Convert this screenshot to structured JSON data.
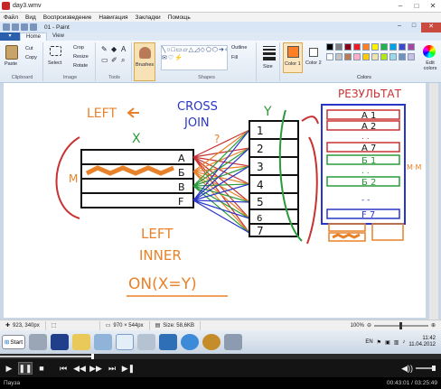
{
  "player": {
    "title": "day3.wmv",
    "menu": [
      "Файл",
      "Вид",
      "Воспроизведение",
      "Навигация",
      "Закладки",
      "Помощь"
    ],
    "status": "Пауза",
    "time": "00:43:01 / 03:25:49",
    "progress": 0.21
  },
  "paint": {
    "title": "01 - Paint",
    "tabs": [
      "Home",
      "View"
    ],
    "ribbon": {
      "clipboard": {
        "paste": "Paste",
        "cut": "Cut",
        "copy": "Copy",
        "label": "Clipboard"
      },
      "image": {
        "select": "Select",
        "crop": "Crop",
        "resize": "Resize",
        "rotate": "Rotate",
        "label": "Image"
      },
      "tools": {
        "label": "Tools"
      },
      "brushes": "Brushes",
      "shapes": {
        "outline": "Outline",
        "fill": "Fill",
        "label": "Shapes"
      },
      "size": "Size",
      "color1": "Color 1",
      "color2": "Color 2",
      "colors_label": "Colors",
      "edit_colors": "Edit colors"
    },
    "palette": [
      "#000000",
      "#7f7f7f",
      "#880015",
      "#ed1c24",
      "#ff7f27",
      "#fff200",
      "#22b14c",
      "#00a2e8",
      "#3f48cc",
      "#a349a4",
      "#ffffff",
      "#c3c3c3",
      "#b97a57",
      "#ffaec9",
      "#ffc90e",
      "#efe4b0",
      "#b5e61d",
      "#99d9ea",
      "#7092be",
      "#c8bfe7"
    ],
    "color1": "#ff7f27",
    "color2": "#ffffff",
    "status": {
      "cursor": "923, 340px",
      "canvas_size": "970 × 544px",
      "file_size": "Size: 58,6KB",
      "zoom": "100%"
    }
  },
  "drawing": {
    "left_title": "LEFT",
    "cross_join": [
      "CROSS",
      "JOIN"
    ],
    "result": "РЕЗУЛЬТАТ",
    "x_label": "X",
    "y_label": "Y",
    "m_left": "M",
    "m_right": "M",
    "q_mark": "?",
    "left_table": [
      "A",
      "Б",
      "B",
      "F"
    ],
    "right_table": [
      "1",
      "2",
      "3",
      "4",
      "5",
      "6",
      "7"
    ],
    "result_rows": [
      "A 1",
      "A 2",
      ". .",
      "A 7",
      "Б 1",
      ". .",
      "Б 2",
      "- -",
      "F 7"
    ],
    "left_inner": [
      "LEFT",
      "INNER"
    ],
    "on_clause": "ON(X=Y)",
    "mxm": "M·M"
  },
  "taskbar": {
    "start": "Start",
    "lang": "EN",
    "time": "11:42",
    "date": "11.04.2012"
  }
}
